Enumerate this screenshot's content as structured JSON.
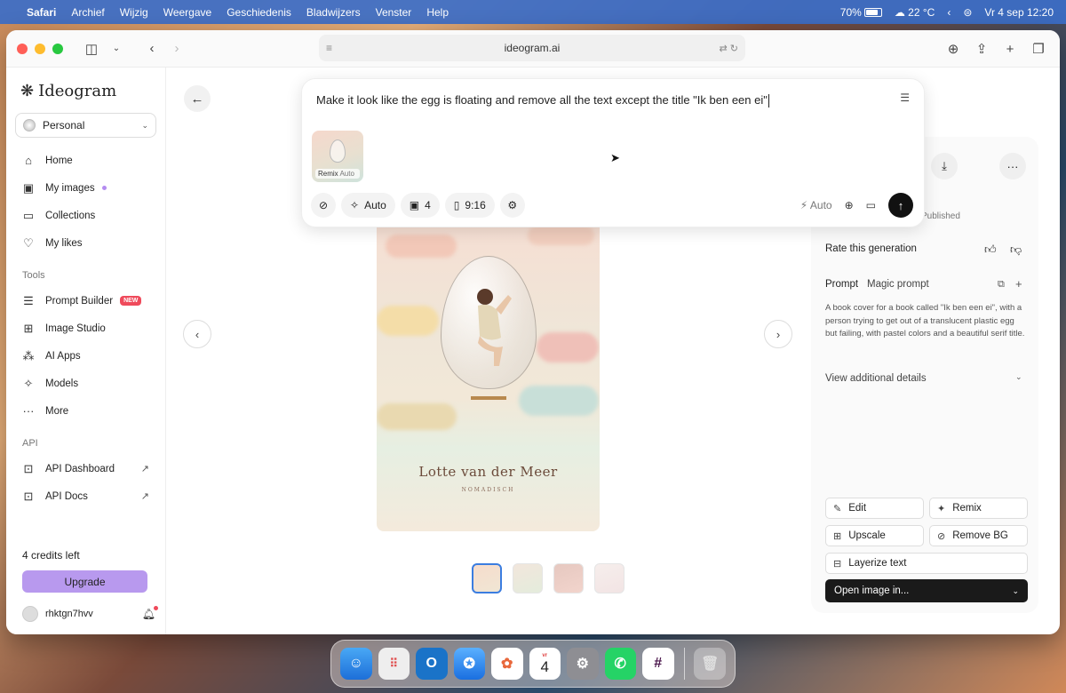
{
  "menubar": {
    "app": "Safari",
    "items": [
      "Archief",
      "Wijzig",
      "Weergave",
      "Geschiedenis",
      "Bladwijzers",
      "Venster",
      "Help"
    ],
    "battery": "70%",
    "weather": "22 °C",
    "datetime": "Vr 4 sep  12:20"
  },
  "browser": {
    "url": "ideogram.ai"
  },
  "sidebar": {
    "logo": "Ideogram",
    "workspace": "Personal",
    "nav": [
      {
        "label": "Home",
        "icon": "home-icon"
      },
      {
        "label": "My images",
        "icon": "images-icon"
      },
      {
        "label": "Collections",
        "icon": "folder-icon"
      },
      {
        "label": "My likes",
        "icon": "heart-icon"
      }
    ],
    "tools_heading": "Tools",
    "tools": [
      {
        "label": "Prompt Builder",
        "badge": "NEW"
      },
      {
        "label": "Image Studio"
      },
      {
        "label": "AI Apps"
      },
      {
        "label": "Models"
      },
      {
        "label": "More"
      }
    ],
    "api_heading": "API",
    "api": [
      {
        "label": "API Dashboard"
      },
      {
        "label": "API Docs"
      }
    ],
    "credits": "4 credits left",
    "upgrade": "Upgrade",
    "username": "rhktgn7hvv"
  },
  "prompt": {
    "text": "Make it look like the egg is floating and remove all the text except the title \"Ik ben een ei\"",
    "remix_label": "Remix",
    "remix_mode": "Auto",
    "style": "Auto",
    "count": "4",
    "aspect": "9:16",
    "magic": "Auto"
  },
  "image": {
    "title": "Lotte van der Meer",
    "subtitle": "NOMADISCH"
  },
  "details": {
    "published": "Published",
    "rate": "Rate this generation",
    "tab_prompt": "Prompt",
    "tab_magic": "Magic prompt",
    "prompt_body": "A book cover for a book called \"Ik ben een ei\", with a person trying to get out of a translucent plastic egg but failing, with pastel colors and a beautiful serif title.",
    "view_details": "View additional details",
    "actions": {
      "edit": "Edit",
      "remix": "Remix",
      "upscale": "Upscale",
      "remove_bg": "Remove BG",
      "layerize": "Layerize text",
      "open": "Open image in..."
    }
  },
  "dock": {
    "calendar_day": "4",
    "calendar_month": "vr"
  }
}
